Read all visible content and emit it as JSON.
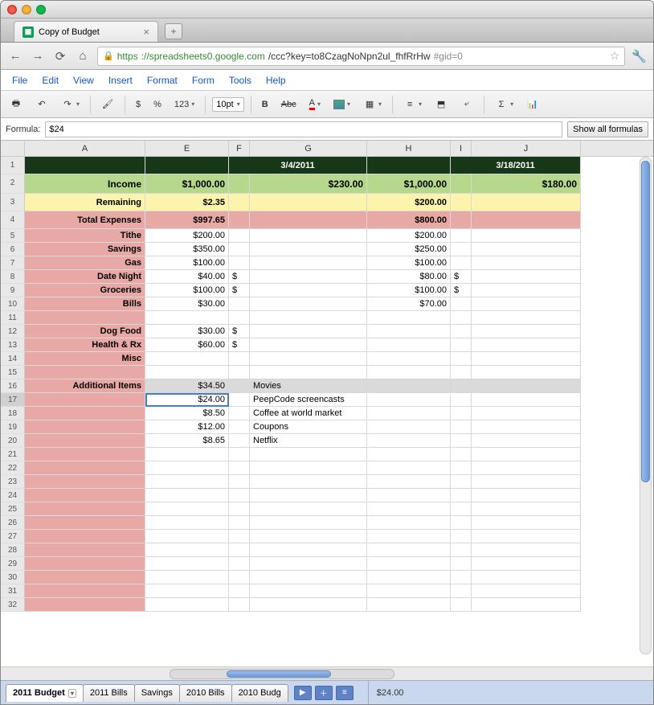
{
  "browser": {
    "tab_title": "Copy of Budget",
    "url_scheme": "https",
    "url_host": "://spreadsheets0.google.com",
    "url_path": "/ccc?key=to8CzagNoNpn2ul_fhfRrHw",
    "url_fragment": "#gid=0"
  },
  "menus": [
    "File",
    "Edit",
    "View",
    "Insert",
    "Format",
    "Form",
    "Tools",
    "Help"
  ],
  "toolbar": {
    "currency": "$",
    "percent": "%",
    "more_formats": "123",
    "font_size": "10pt",
    "bold": "B",
    "strike": "Abc",
    "text_color": "A"
  },
  "formula": {
    "label": "Formula:",
    "value": "$24",
    "show_all": "Show all formulas"
  },
  "columns": [
    "A",
    "E",
    "F",
    "G",
    "H",
    "I",
    "J"
  ],
  "rows": [
    {
      "num": 1,
      "cls": "h1",
      "cells": {
        "A": {
          "v": "",
          "bg": "darkgreen"
        },
        "E": {
          "v": "",
          "bg": "darkgreen"
        },
        "F": {
          "v": "3/4/2011",
          "bg": "darkgreen",
          "span": 2,
          "cls": "bold center"
        },
        "H": {
          "v": "",
          "bg": "darkgreen"
        },
        "I": {
          "v": "3/18/2011",
          "bg": "darkgreen",
          "span": 2,
          "cls": "bold center"
        }
      }
    },
    {
      "num": 2,
      "cls": "h2",
      "cells": {
        "A": {
          "v": "Income",
          "bg": "lightgreen",
          "cls": "right bold"
        },
        "E": {
          "v": "$1,000.00",
          "bg": "lightgreen",
          "cls": "right bold"
        },
        "F": {
          "v": "",
          "bg": "lightgreen"
        },
        "G": {
          "v": "$230.00",
          "bg": "lightgreen",
          "cls": "right bold"
        },
        "H": {
          "v": "$1,000.00",
          "bg": "lightgreen",
          "cls": "right bold"
        },
        "I": {
          "v": "",
          "bg": "lightgreen"
        },
        "J": {
          "v": "$180.00",
          "bg": "lightgreen",
          "cls": "right bold"
        }
      }
    },
    {
      "num": 3,
      "cls": "h3",
      "cells": {
        "A": {
          "v": "Remaining",
          "bg": "yellow",
          "cls": "right bold"
        },
        "E": {
          "v": "$2.35",
          "bg": "yellow",
          "cls": "right bold"
        },
        "F": {
          "v": "",
          "bg": "yellow"
        },
        "G": {
          "v": "",
          "bg": "yellow"
        },
        "H": {
          "v": "$200.00",
          "bg": "yellow",
          "cls": "right bold"
        },
        "I": {
          "v": "",
          "bg": "yellow"
        },
        "J": {
          "v": "",
          "bg": "yellow"
        }
      }
    },
    {
      "num": 4,
      "cls": "h4",
      "cells": {
        "A": {
          "v": "Total Expenses",
          "bg": "pink",
          "cls": "right bold"
        },
        "E": {
          "v": "$997.65",
          "bg": "pink",
          "cls": "right bold"
        },
        "F": {
          "v": "",
          "bg": "pink"
        },
        "G": {
          "v": "",
          "bg": "pink"
        },
        "H": {
          "v": "$800.00",
          "bg": "pink",
          "cls": "right bold"
        },
        "I": {
          "v": "",
          "bg": "pink"
        },
        "J": {
          "v": "",
          "bg": "pink"
        }
      }
    },
    {
      "num": 5,
      "cells": {
        "A": {
          "v": "Tithe",
          "bg": "pink",
          "cls": "right bold"
        },
        "E": {
          "v": "$200.00",
          "cls": "right"
        },
        "H": {
          "v": "$200.00",
          "cls": "right"
        }
      }
    },
    {
      "num": 6,
      "cells": {
        "A": {
          "v": "Savings",
          "bg": "pink",
          "cls": "right bold"
        },
        "E": {
          "v": "$350.00",
          "cls": "right"
        },
        "H": {
          "v": "$250.00",
          "cls": "right"
        }
      }
    },
    {
      "num": 7,
      "cells": {
        "A": {
          "v": "Gas",
          "bg": "pink",
          "cls": "right bold"
        },
        "E": {
          "v": "$100.00",
          "cls": "right"
        },
        "H": {
          "v": "$100.00",
          "cls": "right"
        }
      }
    },
    {
      "num": 8,
      "cells": {
        "A": {
          "v": "Date Night",
          "bg": "pink",
          "cls": "right bold"
        },
        "E": {
          "v": "$40.00",
          "cls": "right"
        },
        "F": {
          "v": "$"
        },
        "H": {
          "v": "$80.00",
          "cls": "right"
        },
        "I": {
          "v": "$"
        }
      }
    },
    {
      "num": 9,
      "cells": {
        "A": {
          "v": "Groceries",
          "bg": "pink",
          "cls": "right bold"
        },
        "E": {
          "v": "$100.00",
          "cls": "right"
        },
        "F": {
          "v": "$"
        },
        "H": {
          "v": "$100.00",
          "cls": "right"
        },
        "I": {
          "v": "$"
        }
      }
    },
    {
      "num": 10,
      "cells": {
        "A": {
          "v": "Bills",
          "bg": "pink",
          "cls": "right bold"
        },
        "E": {
          "v": "$30.00",
          "cls": "right"
        },
        "H": {
          "v": "$70.00",
          "cls": "right"
        }
      }
    },
    {
      "num": 11,
      "cells": {
        "A": {
          "v": "",
          "bg": "pink"
        }
      }
    },
    {
      "num": 12,
      "cells": {
        "A": {
          "v": "Dog Food",
          "bg": "pink",
          "cls": "right bold"
        },
        "E": {
          "v": "$30.00",
          "cls": "right"
        },
        "F": {
          "v": "$"
        }
      }
    },
    {
      "num": 13,
      "cells": {
        "A": {
          "v": "Health & Rx",
          "bg": "pink",
          "cls": "right bold"
        },
        "E": {
          "v": "$60.00",
          "cls": "right"
        },
        "F": {
          "v": "$"
        }
      }
    },
    {
      "num": 14,
      "cells": {
        "A": {
          "v": "Misc",
          "bg": "pink",
          "cls": "right bold"
        }
      }
    },
    {
      "num": 15,
      "cells": {
        "A": {
          "v": "",
          "bg": "pink"
        }
      }
    },
    {
      "num": 16,
      "cells": {
        "A": {
          "v": "Additional Items",
          "bg": "pink",
          "cls": "right bold"
        },
        "E": {
          "v": "$34.50",
          "bg": "gray",
          "cls": "right"
        },
        "F": {
          "v": "",
          "bg": "gray"
        },
        "G": {
          "v": "Movies",
          "bg": "gray"
        },
        "H": {
          "v": "",
          "bg": "gray"
        },
        "I": {
          "v": "",
          "bg": "gray"
        },
        "J": {
          "v": "",
          "bg": "gray"
        }
      }
    },
    {
      "num": 17,
      "sel": true,
      "cells": {
        "A": {
          "v": "",
          "bg": "pink"
        },
        "E": {
          "v": "$24.00",
          "cls": "right",
          "sel": true
        },
        "G": {
          "v": "PeepCode screencasts"
        }
      }
    },
    {
      "num": 18,
      "cells": {
        "A": {
          "v": "",
          "bg": "pink"
        },
        "E": {
          "v": "$8.50",
          "cls": "right"
        },
        "G": {
          "v": "Coffee at world market"
        }
      }
    },
    {
      "num": 19,
      "cells": {
        "A": {
          "v": "",
          "bg": "pink"
        },
        "E": {
          "v": "$12.00",
          "cls": "right"
        },
        "G": {
          "v": "Coupons"
        }
      }
    },
    {
      "num": 20,
      "cells": {
        "A": {
          "v": "",
          "bg": "pink"
        },
        "E": {
          "v": "$8.65",
          "cls": "right"
        },
        "G": {
          "v": "Netflix"
        }
      }
    },
    {
      "num": 21,
      "cells": {
        "A": {
          "v": "",
          "bg": "pink"
        }
      }
    },
    {
      "num": 22,
      "cells": {
        "A": {
          "v": "",
          "bg": "pink"
        }
      }
    },
    {
      "num": 23,
      "cells": {
        "A": {
          "v": "",
          "bg": "pink"
        }
      }
    },
    {
      "num": 24,
      "cells": {
        "A": {
          "v": "",
          "bg": "pink"
        }
      }
    },
    {
      "num": 25,
      "cells": {
        "A": {
          "v": "",
          "bg": "pink"
        }
      }
    },
    {
      "num": 26,
      "cells": {
        "A": {
          "v": "",
          "bg": "pink"
        }
      }
    },
    {
      "num": 27,
      "cells": {
        "A": {
          "v": "",
          "bg": "pink"
        }
      }
    },
    {
      "num": 28,
      "cells": {
        "A": {
          "v": "",
          "bg": "pink"
        }
      }
    },
    {
      "num": 29,
      "cells": {
        "A": {
          "v": "",
          "bg": "pink"
        }
      }
    },
    {
      "num": 30,
      "cells": {
        "A": {
          "v": "",
          "bg": "pink"
        }
      }
    },
    {
      "num": 31,
      "cells": {
        "A": {
          "v": "",
          "bg": "pink"
        }
      }
    },
    {
      "num": 32,
      "cells": {
        "A": {
          "v": "",
          "bg": "pink"
        }
      }
    }
  ],
  "sheet_tabs": [
    "2011 Budget",
    "2011 Bills",
    "Savings",
    "2010 Bills",
    "2010 Budg"
  ],
  "active_sheet": 0,
  "status": "$24.00"
}
